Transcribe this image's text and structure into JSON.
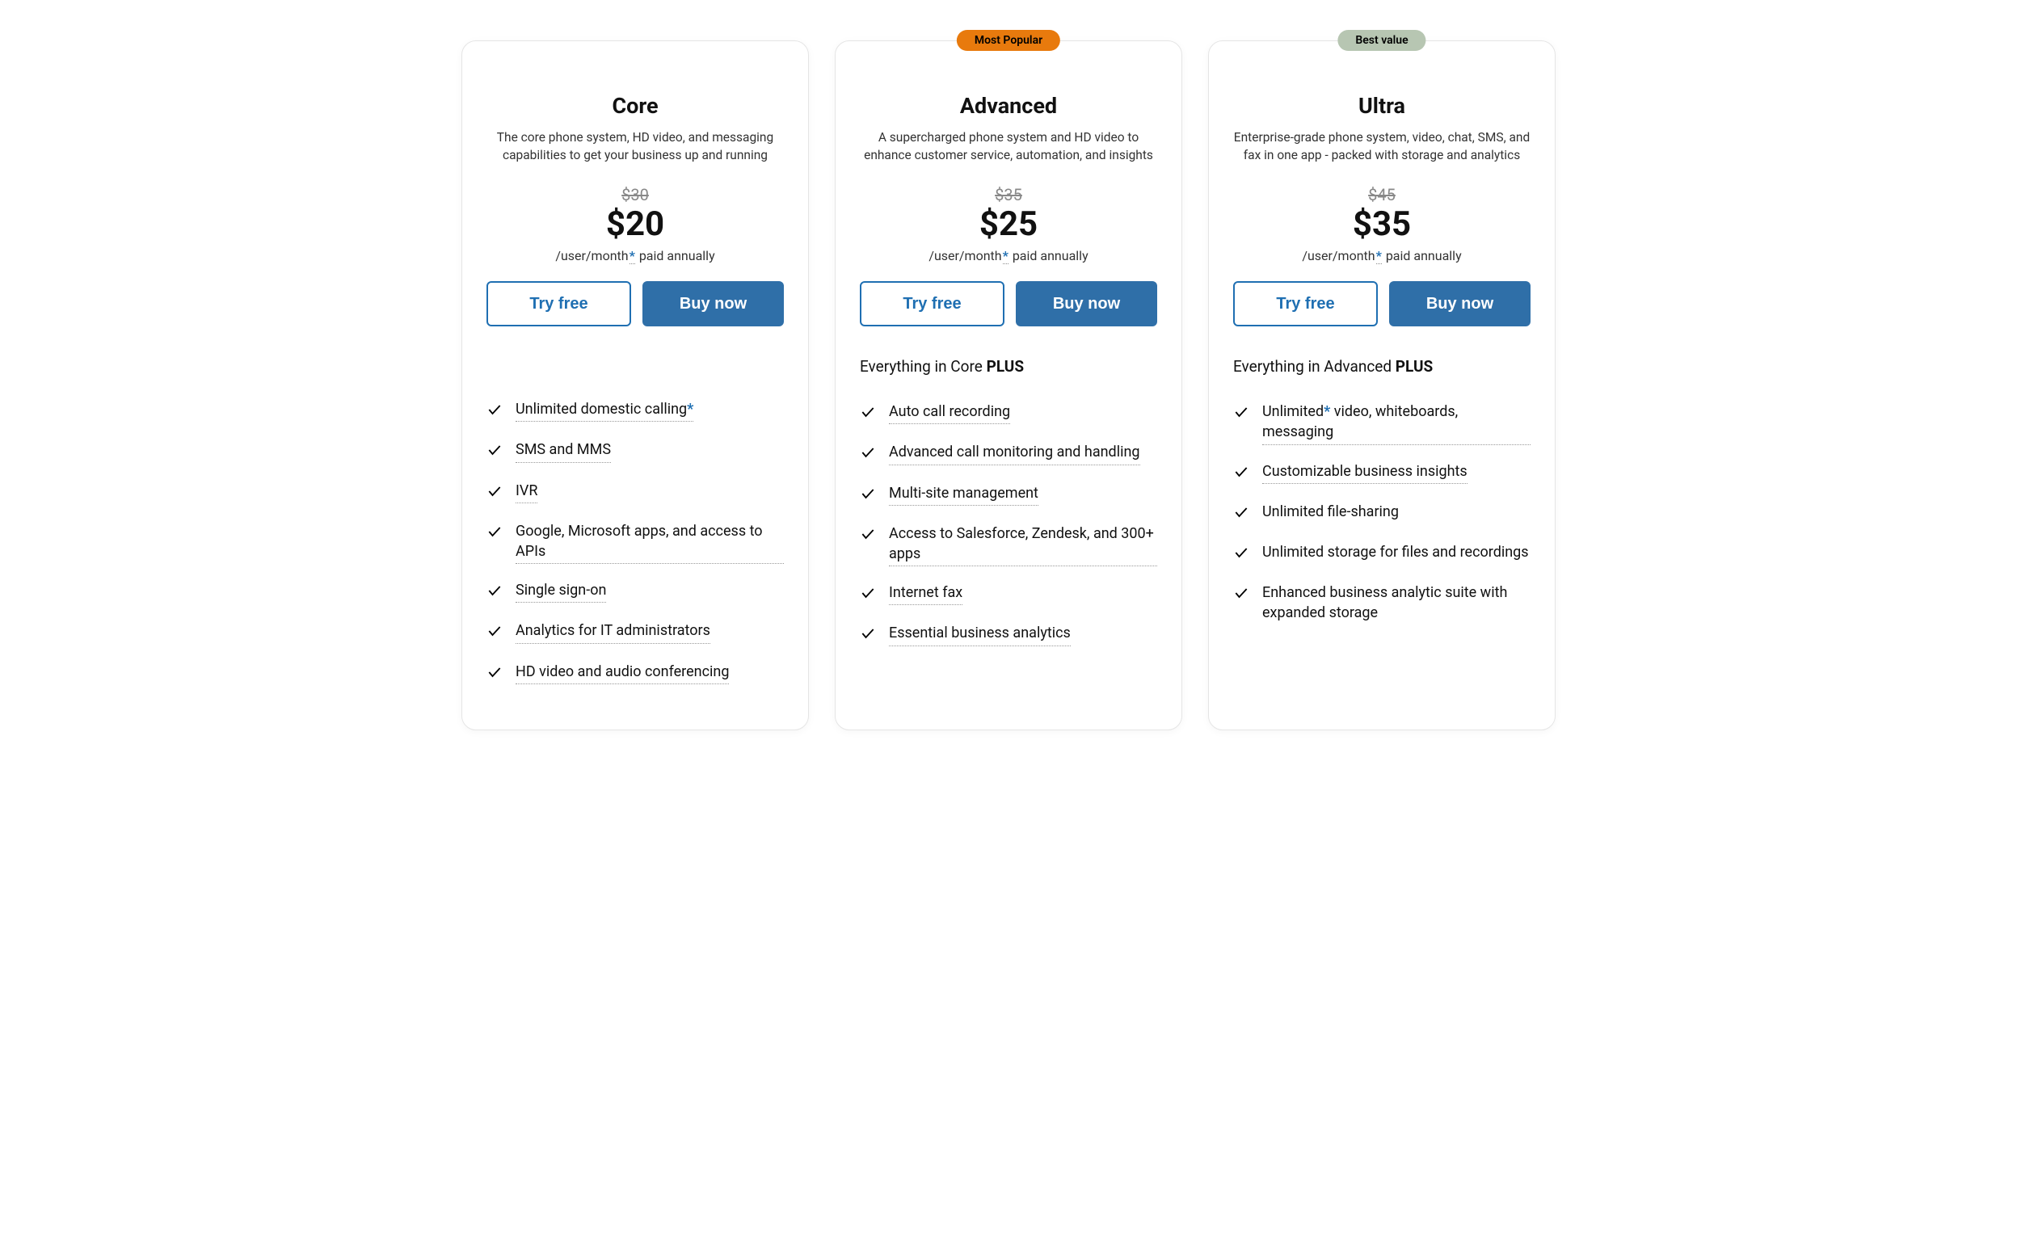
{
  "common": {
    "try_label": "Try free",
    "buy_label": "Buy now",
    "unit_prefix": "/user/month",
    "asterisk": "*",
    "unit_suffix": "paid annually"
  },
  "plans": [
    {
      "name": "Core",
      "description": "The core phone system, HD video, and messaging capabilities to get your business up and running",
      "old_price": "$30",
      "price": "$20",
      "badge": null,
      "everything_prefix": null,
      "features": [
        {
          "text": "Unlimited domestic calling",
          "asterisk": true,
          "underline": true
        },
        {
          "text": "SMS and MMS",
          "underline": true
        },
        {
          "text": "IVR",
          "underline": true
        },
        {
          "text": "Google, Microsoft apps, and access to APIs",
          "underline": true
        },
        {
          "text": "Single sign-on",
          "underline": true
        },
        {
          "text": "Analytics for IT administrators",
          "underline": true
        },
        {
          "text": "HD video and audio conferencing",
          "underline": true
        }
      ]
    },
    {
      "name": "Advanced",
      "description": "A supercharged phone system and HD video to enhance customer service, automation, and insights",
      "old_price": "$35",
      "price": "$25",
      "badge": {
        "text": "Most Popular",
        "style": "popular"
      },
      "everything_prefix": "Everything in Core",
      "everything_plus": "PLUS",
      "features": [
        {
          "text": "Auto call recording",
          "underline": true
        },
        {
          "text": "Advanced call monitoring and handling",
          "underline": true
        },
        {
          "text": "Multi-site management",
          "underline": true
        },
        {
          "text": "Access to Salesforce, Zendesk, and 300+ apps",
          "underline": true
        },
        {
          "text": "Internet fax",
          "underline": true
        },
        {
          "text": "Essential business analytics",
          "underline": true
        }
      ]
    },
    {
      "name": "Ultra",
      "description": "Enterprise-grade phone system, video, chat, SMS, and fax in one app - packed with storage and analytics",
      "old_price": "$45",
      "price": "$35",
      "badge": {
        "text": "Best value",
        "style": "value"
      },
      "everything_prefix": "Everything in Advanced",
      "everything_plus": "PLUS",
      "features": [
        {
          "text_pre": "Unlimited",
          "asterisk_mid": true,
          "text_post": " video, whiteboards, messaging",
          "underline": true
        },
        {
          "text": "Customizable business insights",
          "underline": true
        },
        {
          "text": "Unlimited file-sharing",
          "underline": false
        },
        {
          "text": "Unlimited storage for files and recordings",
          "underline": false
        },
        {
          "text": "Enhanced business analytic suite with expanded storage",
          "underline": false
        }
      ]
    }
  ]
}
